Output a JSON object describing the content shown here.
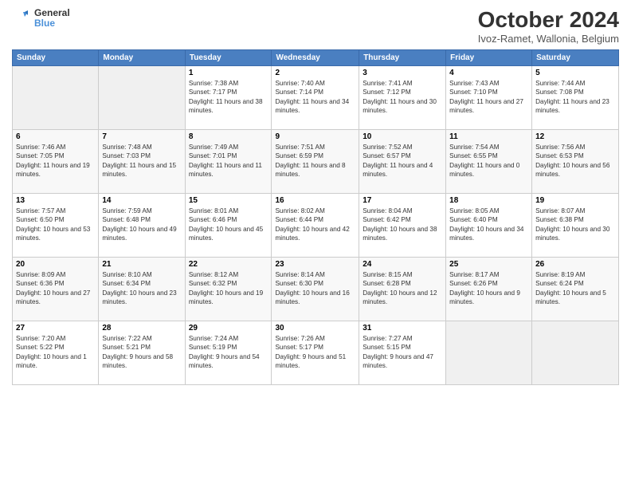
{
  "logo": {
    "line1": "General",
    "line2": "Blue"
  },
  "title": "October 2024",
  "subtitle": "Ivoz-Ramet, Wallonia, Belgium",
  "days_header": [
    "Sunday",
    "Monday",
    "Tuesday",
    "Wednesday",
    "Thursday",
    "Friday",
    "Saturday"
  ],
  "weeks": [
    [
      {
        "day": "",
        "info": ""
      },
      {
        "day": "",
        "info": ""
      },
      {
        "day": "1",
        "info": "Sunrise: 7:38 AM\nSunset: 7:17 PM\nDaylight: 11 hours and 38 minutes."
      },
      {
        "day": "2",
        "info": "Sunrise: 7:40 AM\nSunset: 7:14 PM\nDaylight: 11 hours and 34 minutes."
      },
      {
        "day": "3",
        "info": "Sunrise: 7:41 AM\nSunset: 7:12 PM\nDaylight: 11 hours and 30 minutes."
      },
      {
        "day": "4",
        "info": "Sunrise: 7:43 AM\nSunset: 7:10 PM\nDaylight: 11 hours and 27 minutes."
      },
      {
        "day": "5",
        "info": "Sunrise: 7:44 AM\nSunset: 7:08 PM\nDaylight: 11 hours and 23 minutes."
      }
    ],
    [
      {
        "day": "6",
        "info": "Sunrise: 7:46 AM\nSunset: 7:05 PM\nDaylight: 11 hours and 19 minutes."
      },
      {
        "day": "7",
        "info": "Sunrise: 7:48 AM\nSunset: 7:03 PM\nDaylight: 11 hours and 15 minutes."
      },
      {
        "day": "8",
        "info": "Sunrise: 7:49 AM\nSunset: 7:01 PM\nDaylight: 11 hours and 11 minutes."
      },
      {
        "day": "9",
        "info": "Sunrise: 7:51 AM\nSunset: 6:59 PM\nDaylight: 11 hours and 8 minutes."
      },
      {
        "day": "10",
        "info": "Sunrise: 7:52 AM\nSunset: 6:57 PM\nDaylight: 11 hours and 4 minutes."
      },
      {
        "day": "11",
        "info": "Sunrise: 7:54 AM\nSunset: 6:55 PM\nDaylight: 11 hours and 0 minutes."
      },
      {
        "day": "12",
        "info": "Sunrise: 7:56 AM\nSunset: 6:53 PM\nDaylight: 10 hours and 56 minutes."
      }
    ],
    [
      {
        "day": "13",
        "info": "Sunrise: 7:57 AM\nSunset: 6:50 PM\nDaylight: 10 hours and 53 minutes."
      },
      {
        "day": "14",
        "info": "Sunrise: 7:59 AM\nSunset: 6:48 PM\nDaylight: 10 hours and 49 minutes."
      },
      {
        "day": "15",
        "info": "Sunrise: 8:01 AM\nSunset: 6:46 PM\nDaylight: 10 hours and 45 minutes."
      },
      {
        "day": "16",
        "info": "Sunrise: 8:02 AM\nSunset: 6:44 PM\nDaylight: 10 hours and 42 minutes."
      },
      {
        "day": "17",
        "info": "Sunrise: 8:04 AM\nSunset: 6:42 PM\nDaylight: 10 hours and 38 minutes."
      },
      {
        "day": "18",
        "info": "Sunrise: 8:05 AM\nSunset: 6:40 PM\nDaylight: 10 hours and 34 minutes."
      },
      {
        "day": "19",
        "info": "Sunrise: 8:07 AM\nSunset: 6:38 PM\nDaylight: 10 hours and 30 minutes."
      }
    ],
    [
      {
        "day": "20",
        "info": "Sunrise: 8:09 AM\nSunset: 6:36 PM\nDaylight: 10 hours and 27 minutes."
      },
      {
        "day": "21",
        "info": "Sunrise: 8:10 AM\nSunset: 6:34 PM\nDaylight: 10 hours and 23 minutes."
      },
      {
        "day": "22",
        "info": "Sunrise: 8:12 AM\nSunset: 6:32 PM\nDaylight: 10 hours and 19 minutes."
      },
      {
        "day": "23",
        "info": "Sunrise: 8:14 AM\nSunset: 6:30 PM\nDaylight: 10 hours and 16 minutes."
      },
      {
        "day": "24",
        "info": "Sunrise: 8:15 AM\nSunset: 6:28 PM\nDaylight: 10 hours and 12 minutes."
      },
      {
        "day": "25",
        "info": "Sunrise: 8:17 AM\nSunset: 6:26 PM\nDaylight: 10 hours and 9 minutes."
      },
      {
        "day": "26",
        "info": "Sunrise: 8:19 AM\nSunset: 6:24 PM\nDaylight: 10 hours and 5 minutes."
      }
    ],
    [
      {
        "day": "27",
        "info": "Sunrise: 7:20 AM\nSunset: 5:22 PM\nDaylight: 10 hours and 1 minute."
      },
      {
        "day": "28",
        "info": "Sunrise: 7:22 AM\nSunset: 5:21 PM\nDaylight: 9 hours and 58 minutes."
      },
      {
        "day": "29",
        "info": "Sunrise: 7:24 AM\nSunset: 5:19 PM\nDaylight: 9 hours and 54 minutes."
      },
      {
        "day": "30",
        "info": "Sunrise: 7:26 AM\nSunset: 5:17 PM\nDaylight: 9 hours and 51 minutes."
      },
      {
        "day": "31",
        "info": "Sunrise: 7:27 AM\nSunset: 5:15 PM\nDaylight: 9 hours and 47 minutes."
      },
      {
        "day": "",
        "info": ""
      },
      {
        "day": "",
        "info": ""
      }
    ]
  ]
}
